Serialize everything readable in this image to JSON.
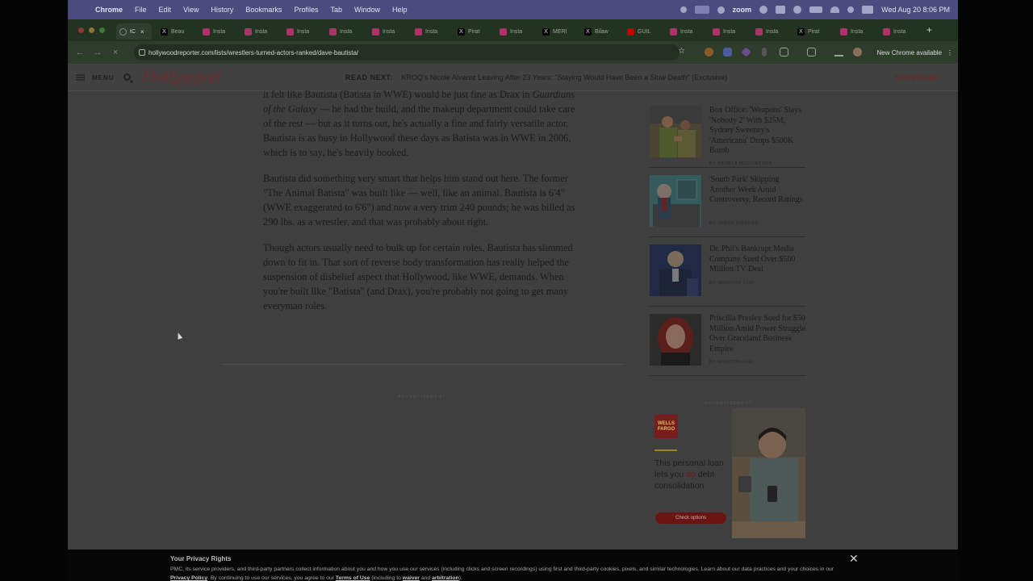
{
  "menubar": {
    "app": "Chrome",
    "items": [
      "File",
      "Edit",
      "View",
      "History",
      "Bookmarks",
      "Profiles",
      "Tab",
      "Window",
      "Help"
    ],
    "zoom_label": "zoom",
    "datetime": "Wed Aug 20  8:06 PM"
  },
  "tabs": [
    {
      "label": "tC",
      "icon": "loading-icon",
      "color": "#888888"
    },
    {
      "label": "Beau",
      "icon": "x-logo-icon",
      "color": "#000000"
    },
    {
      "label": "Insta",
      "icon": "instagram-icon",
      "color": "#b0306a"
    },
    {
      "label": "Insta",
      "icon": "instagram-icon",
      "color": "#b0306a"
    },
    {
      "label": "Insta",
      "icon": "instagram-icon",
      "color": "#b0306a"
    },
    {
      "label": "Insta",
      "icon": "instagram-icon",
      "color": "#b0306a"
    },
    {
      "label": "Insta",
      "icon": "instagram-icon",
      "color": "#b0306a"
    },
    {
      "label": "Insta",
      "icon": "instagram-icon",
      "color": "#b0306a"
    },
    {
      "label": "Pirat",
      "icon": "x-logo-icon",
      "color": "#000000"
    },
    {
      "label": "Insta",
      "icon": "instagram-icon",
      "color": "#b0306a"
    },
    {
      "label": "MERI",
      "icon": "x-logo-icon",
      "color": "#000000"
    },
    {
      "label": "Bilaw",
      "icon": "x-logo-icon",
      "color": "#000000"
    },
    {
      "label": "GUIL",
      "icon": "youtube-icon",
      "color": "#c00000"
    },
    {
      "label": "Insta",
      "icon": "instagram-icon",
      "color": "#b0306a"
    },
    {
      "label": "Insta",
      "icon": "instagram-icon",
      "color": "#b0306a"
    },
    {
      "label": "Insta",
      "icon": "instagram-icon",
      "color": "#b0306a"
    },
    {
      "label": "Pirat",
      "icon": "x-logo-icon",
      "color": "#000000"
    },
    {
      "label": "Insta",
      "icon": "instagram-icon",
      "color": "#b0306a"
    },
    {
      "label": "Insta",
      "icon": "instagram-icon",
      "color": "#b0306a"
    }
  ],
  "toolbar": {
    "url": "hollywoodreporter.com/lists/wrestlers-turned-actors-ranked/dave-bautista/",
    "update_label": "New Chrome available"
  },
  "header": {
    "menu_label": "MENU",
    "logo": "Hollywood",
    "logo_sub": "REPORTER",
    "read_next_label": "READ NEXT:",
    "read_next_title": "KROQ's Nicole Alvarez Leaving After 23 Years: \"Staying Would Have Been a Slow Death\" (Exclusive)",
    "subscribe_label": "SUBSCRIBE"
  },
  "article": {
    "p1_before": "it felt like Bautista (Batista in WWE) would be just fine as Drax in ",
    "p1_italic": "Guardians of the Galaxy",
    "p1_after": " — he had the build, and the makeup department could take care of the rest — but as it turns out, he's actually a fine and fairly versatile actor. Bautista is as busy in Hollywood these days as Batista was in WWE in 2006, which is to say, he's heavily booked.",
    "p2": "Bautista did something very smart that helps him stand out here. The former \"The Animal Batista\" was built like — well, like an animal. Bautista is 6'4\" (WWE exaggerated to 6'6\") and now a very trim 240 pounds; he was billed as 290 lbs. as a wrestler, and that was probably about right.",
    "p3": "Though actors usually need to bulk up for certain roles, Bautista has slimmed down to fit in. That sort of reverse body transformation has really helped the suspension of disbelief aspect that Hollywood, like WWE, demands. When you're built like \"Batista\" (and Drax), you're probably not going to get many everyman roles.",
    "ad_label": "ADVERTISEMENT"
  },
  "sidebar": {
    "items": [
      {
        "title": "Box Office: 'Weapons' Slays 'Nobody 2' With $25M, Sydney Sweeney's 'Americana' Drops $500K Bomb",
        "byline": "BY PAMELA MCCLINTOCK"
      },
      {
        "title": "'South Park' Skipping Another Week Amid Controversy, Record Ratings",
        "byline": "BY JAMES HIBBERD"
      },
      {
        "title": "Dr. Phil's Bankrupt Media Company Sued Over $500 Million TV Deal",
        "byline": "BY WINSTON CHO"
      },
      {
        "title": "Priscilla Presley Sued for $50 Million Amid Power Struggle Over Graceland Business Empire",
        "byline": "BY WINSTON CHO"
      }
    ],
    "ad_label": "ADVERTISEMENT"
  },
  "ad": {
    "brand_line1": "WELLS",
    "brand_line2": "FARGO",
    "text_before": "This personal loan lets you ",
    "text_accent": "do",
    "text_after": " debt consolidation",
    "cta": "Check options"
  },
  "privacy": {
    "title": "Your Privacy Rights",
    "text1": "PMC, its service providers, and third-party partners collect information about you and how you use our services (including clicks and screen recordings) using first and third-party cookies, pixels, and similar technologies. Learn about our data practices and your choices in our ",
    "link1": "Privacy Policy",
    "text2": ". By continuing to use our services, you agree to our ",
    "link2": "Terms of Use",
    "text3": " (including to ",
    "link3": "waiver",
    "text4": " and ",
    "link4": "arbitration",
    "text5": ")."
  },
  "colors": {
    "brand_red": "#6f2626",
    "overlay_dim": "#3f3f3f"
  }
}
